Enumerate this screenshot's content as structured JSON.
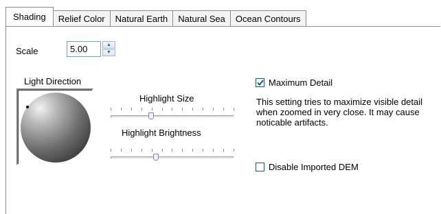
{
  "tabs": [
    {
      "label": "Shading",
      "active": true
    },
    {
      "label": "Relief Color",
      "active": false
    },
    {
      "label": "Natural Earth",
      "active": false
    },
    {
      "label": "Natural Sea",
      "active": false
    },
    {
      "label": "Ocean Contours",
      "active": false
    }
  ],
  "scale": {
    "label": "Scale",
    "value": "5.00"
  },
  "light_direction": {
    "label": "Light Direction"
  },
  "highlight_size": {
    "label": "Highlight Size",
    "level": 0.32
  },
  "highlight_brightness": {
    "label": "Highlight Brightness",
    "level": 0.36
  },
  "maximum_detail": {
    "label": "Maximum Detail",
    "checked": true,
    "description": "This setting tries to maximize visible detail when zoomed in very close.  It may cause noticable artifacts."
  },
  "disable_imported_dem": {
    "label": "Disable Imported DEM",
    "checked": false
  },
  "colors": {
    "checkmark": "#1c5180",
    "border": "#8c8c8c"
  }
}
